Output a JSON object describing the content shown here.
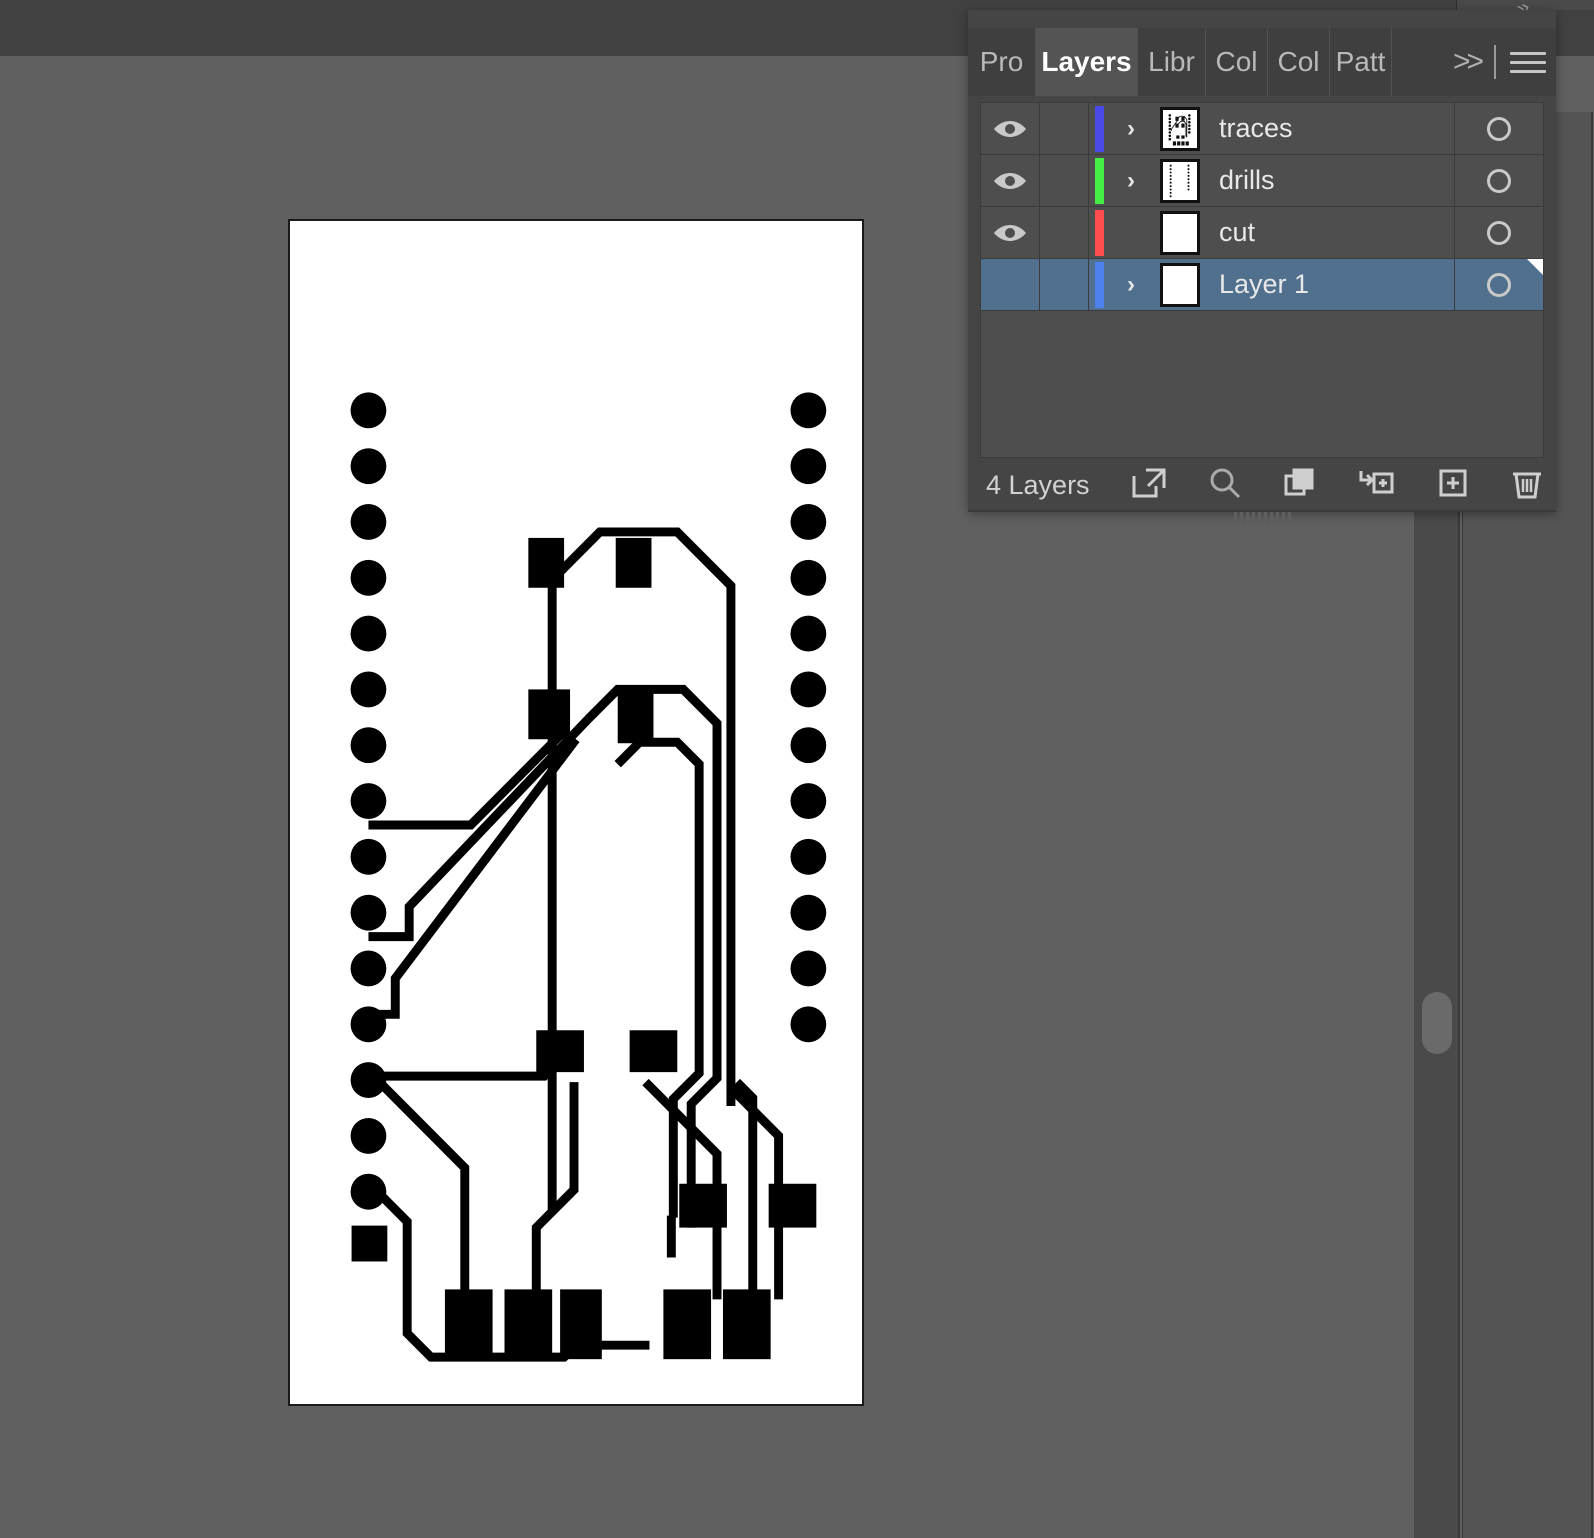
{
  "app": {
    "background_color": "#606060",
    "topbar_color": "#414141"
  },
  "panel": {
    "title": "Layers",
    "tabs": [
      {
        "label": "Pro",
        "active": false,
        "name": "tab-properties"
      },
      {
        "label": "Layers",
        "active": true,
        "name": "tab-layers"
      },
      {
        "label": "Libr",
        "active": false,
        "name": "tab-libraries"
      },
      {
        "label": "Col",
        "active": false,
        "name": "tab-color"
      },
      {
        "label": "Col",
        "active": false,
        "name": "tab-color-guide"
      },
      {
        "label": "Patt",
        "active": false,
        "name": "tab-pattern"
      }
    ],
    "overflow_label": ">>",
    "menu_icon": "hamburger-icon",
    "footer": {
      "count_label": "4 Layers",
      "icons": [
        {
          "name": "release-to-layers-icon",
          "title": "Make/Release Clipping Mask"
        },
        {
          "name": "locate-object-icon",
          "title": "Locate Object"
        },
        {
          "name": "duplicate-selection-icon",
          "title": "Duplicate Selection"
        },
        {
          "name": "collect-into-new-layer-icon",
          "title": "Collect in New Layer"
        },
        {
          "name": "new-layer-icon",
          "title": "Create New Layer"
        },
        {
          "name": "delete-layer-icon",
          "title": "Delete Selection"
        }
      ]
    },
    "layers": [
      {
        "name": "traces",
        "visible": true,
        "locked": false,
        "selected": false,
        "expandable": true,
        "color": "#4a4ae8",
        "thumbnail": "pcb-traces",
        "target_state": "empty"
      },
      {
        "name": "drills",
        "visible": true,
        "locked": false,
        "selected": false,
        "expandable": true,
        "color": "#44ee44",
        "thumbnail": "drill-columns",
        "target_state": "empty"
      },
      {
        "name": "cut",
        "visible": true,
        "locked": false,
        "selected": false,
        "expandable": false,
        "color": "#ff4d4d",
        "thumbnail": "blank",
        "target_state": "empty"
      },
      {
        "name": "Layer 1",
        "visible": false,
        "locked": false,
        "selected": true,
        "expandable": true,
        "color": "#4d82ee",
        "thumbnail": "blank",
        "target_state": "empty"
      }
    ]
  },
  "artboard": {
    "name": "pcb-artwork",
    "background": "#ffffff",
    "stroke": "#000000",
    "description": "PCB layout showing drilled castellated pads along both vertical edges, SMD pads and routed copper traces"
  }
}
